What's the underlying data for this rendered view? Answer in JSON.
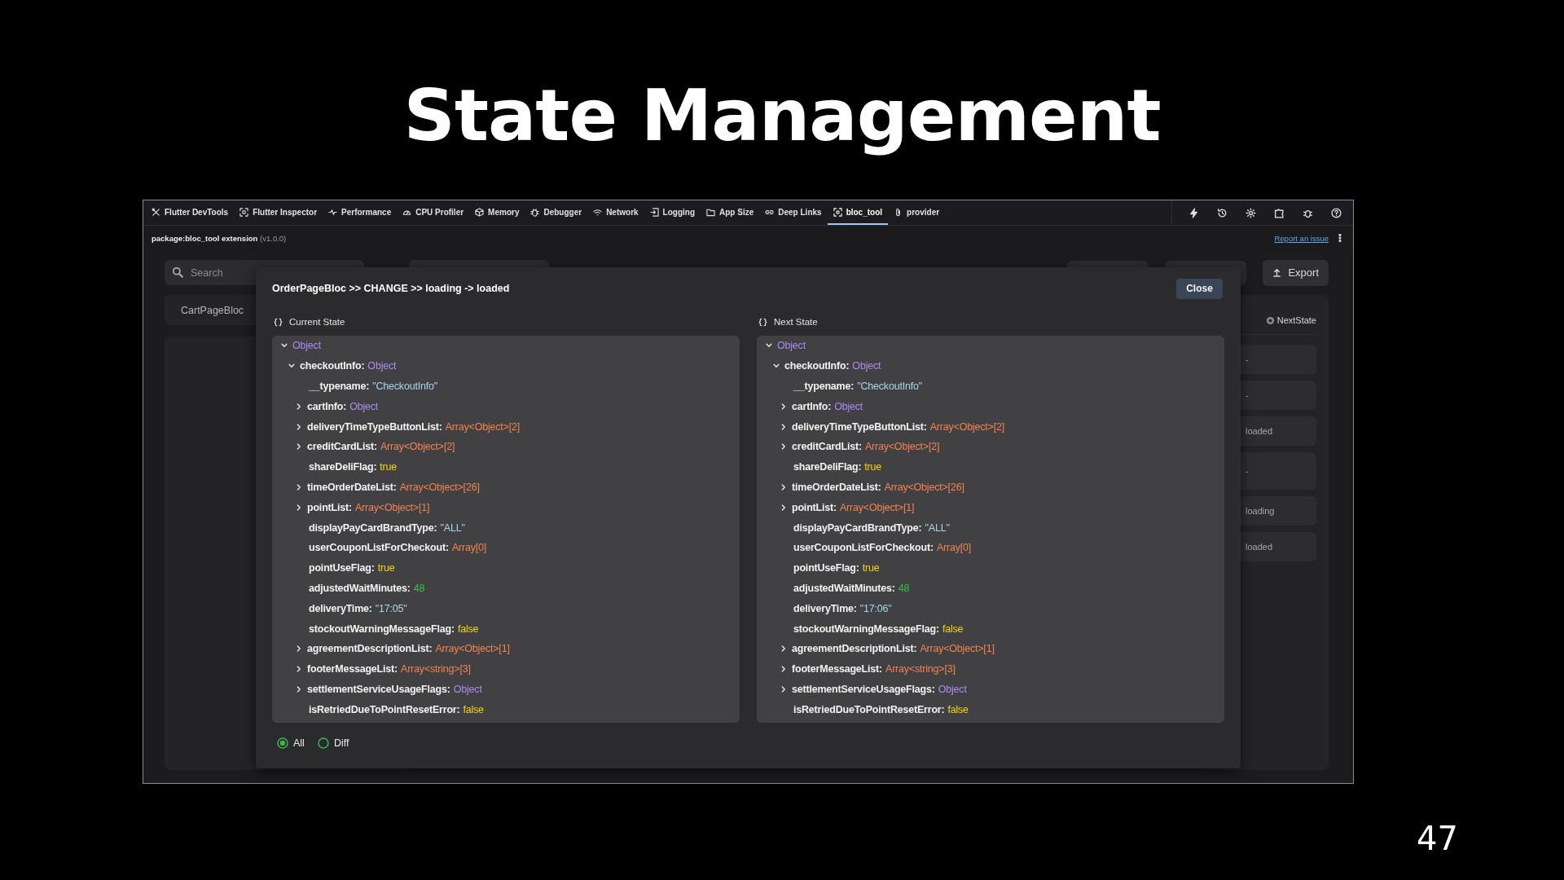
{
  "slide": {
    "title": "State Management",
    "page_number": "47"
  },
  "devtools": {
    "tabs": [
      {
        "label": "Flutter DevTools",
        "selected": false
      },
      {
        "label": "Flutter Inspector",
        "selected": false
      },
      {
        "label": "Performance",
        "selected": false
      },
      {
        "label": "CPU Profiler",
        "selected": false
      },
      {
        "label": "Memory",
        "selected": false
      },
      {
        "label": "Debugger",
        "selected": false
      },
      {
        "label": "Network",
        "selected": false
      },
      {
        "label": "Logging",
        "selected": false
      },
      {
        "label": "App Size",
        "selected": false
      },
      {
        "label": "Deep Links",
        "selected": false
      },
      {
        "label": "bloc_tool",
        "selected": true
      },
      {
        "label": "provider",
        "selected": false
      }
    ],
    "extension": "**package:bloc_tool extension** (v1.0.0)",
    "report_link": "Report an issue",
    "search": {
      "placeholder": "Search"
    },
    "export_button": "Export",
    "bloc_list": [
      "CartPageBloc"
    ],
    "state_list": {
      "header": "NextState",
      "items": [
        "-",
        "-",
        "loaded",
        "-",
        "loading",
        "loaded"
      ]
    }
  },
  "dialog": {
    "title": "OrderPageBloc >> CHANGE >> loading -> loaded",
    "close_button": "Close",
    "panels": [
      {
        "label": "Current State",
        "tree": {
          "value": "Object",
          "kind": "object",
          "expanded": true,
          "children": [
            {
              "key": "checkoutInfo:",
              "value": "Object",
              "kind": "object",
              "expanded": true,
              "children": [
                {
                  "key": "__typename:",
                  "value": "\"CheckoutInfo\"",
                  "kind": "string"
                },
                {
                  "key": "cartInfo:",
                  "value": "Object",
                  "kind": "object",
                  "expanded": false
                },
                {
                  "key": "deliveryTimeTypeButtonList:",
                  "value": "Array<Object>[2]",
                  "kind": "array",
                  "expanded": false
                },
                {
                  "key": "creditCardList:",
                  "value": "Array<Object>[2]",
                  "kind": "array",
                  "expanded": false
                },
                {
                  "key": "shareDeliFlag:",
                  "value": "true",
                  "kind": "boolean"
                },
                {
                  "key": "timeOrderDateList:",
                  "value": "Array<Object>[26]",
                  "kind": "array",
                  "expanded": false
                },
                {
                  "key": "pointList:",
                  "value": "Array<Object>[1]",
                  "kind": "array",
                  "expanded": false
                },
                {
                  "key": "displayPayCardBrandType:",
                  "value": "\"ALL\"",
                  "kind": "string"
                },
                {
                  "key": "userCouponListForCheckout:",
                  "value": "Array[0]",
                  "kind": "array"
                },
                {
                  "key": "pointUseFlag:",
                  "value": "true",
                  "kind": "boolean"
                },
                {
                  "key": "adjustedWaitMinutes:",
                  "value": "48",
                  "kind": "number"
                },
                {
                  "key": "deliveryTime:",
                  "value": "\"17:05\"",
                  "kind": "string"
                },
                {
                  "key": "stockoutWarningMessageFlag:",
                  "value": "false",
                  "kind": "boolean"
                },
                {
                  "key": "agreementDescriptionList:",
                  "value": "Array<Object>[1]",
                  "kind": "array",
                  "expanded": false
                },
                {
                  "key": "footerMessageList:",
                  "value": "Array<string>[3]",
                  "kind": "array",
                  "expanded": false
                },
                {
                  "key": "settlementServiceUsageFlags:",
                  "value": "Object",
                  "kind": "object",
                  "expanded": false
                },
                {
                  "key": "isRetriedDueToPointResetError:",
                  "value": "false",
                  "kind": "boolean"
                }
              ]
            }
          ]
        }
      },
      {
        "label": "Next State",
        "tree": {
          "value": "Object",
          "kind": "object",
          "expanded": true,
          "children": [
            {
              "key": "checkoutInfo:",
              "value": "Object",
              "kind": "object",
              "expanded": true,
              "children": [
                {
                  "key": "__typename:",
                  "value": "\"CheckoutInfo\"",
                  "kind": "string"
                },
                {
                  "key": "cartInfo:",
                  "value": "Object",
                  "kind": "object",
                  "expanded": false
                },
                {
                  "key": "deliveryTimeTypeButtonList:",
                  "value": "Array<Object>[2]",
                  "kind": "array",
                  "expanded": false
                },
                {
                  "key": "creditCardList:",
                  "value": "Array<Object>[2]",
                  "kind": "array",
                  "expanded": false
                },
                {
                  "key": "shareDeliFlag:",
                  "value": "true",
                  "kind": "boolean"
                },
                {
                  "key": "timeOrderDateList:",
                  "value": "Array<Object>[26]",
                  "kind": "array",
                  "expanded": false
                },
                {
                  "key": "pointList:",
                  "value": "Array<Object>[1]",
                  "kind": "array",
                  "expanded": false
                },
                {
                  "key": "displayPayCardBrandType:",
                  "value": "\"ALL\"",
                  "kind": "string"
                },
                {
                  "key": "userCouponListForCheckout:",
                  "value": "Array[0]",
                  "kind": "array"
                },
                {
                  "key": "pointUseFlag:",
                  "value": "true",
                  "kind": "boolean"
                },
                {
                  "key": "adjustedWaitMinutes:",
                  "value": "48",
                  "kind": "number"
                },
                {
                  "key": "deliveryTime:",
                  "value": "\"17:06\"",
                  "kind": "string"
                },
                {
                  "key": "stockoutWarningMessageFlag:",
                  "value": "false",
                  "kind": "boolean"
                },
                {
                  "key": "agreementDescriptionList:",
                  "value": "Array<Object>[1]",
                  "kind": "array",
                  "expanded": false
                },
                {
                  "key": "footerMessageList:",
                  "value": "Array<string>[3]",
                  "kind": "array",
                  "expanded": false
                },
                {
                  "key": "settlementServiceUsageFlags:",
                  "value": "Object",
                  "kind": "object",
                  "expanded": false
                },
                {
                  "key": "isRetriedDueToPointResetError:",
                  "value": "false",
                  "kind": "boolean"
                }
              ]
            }
          ]
        }
      }
    ],
    "view_options": [
      {
        "label": "All",
        "selected": true
      },
      {
        "label": "Diff",
        "selected": false
      }
    ]
  }
}
